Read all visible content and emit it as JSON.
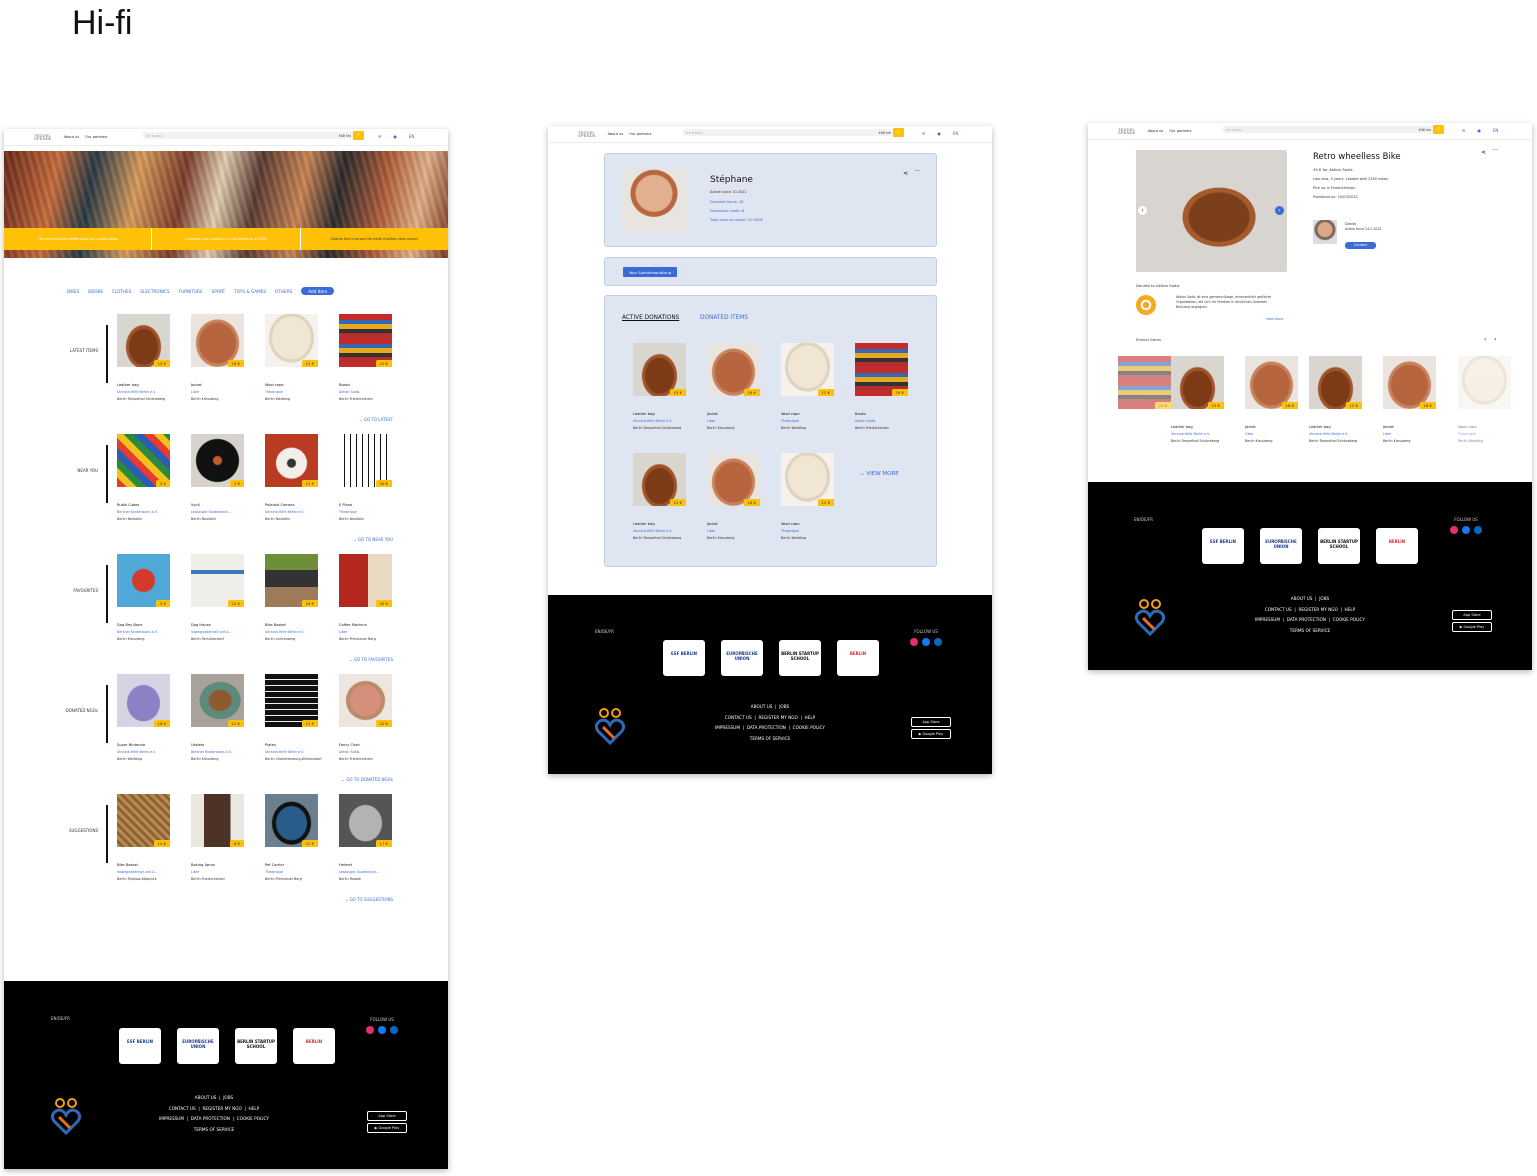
{
  "heading": "Hi-fi",
  "nav": {
    "logo_line1": "TEDDEL",
    "logo_line2": "SPENDE",
    "links": [
      "About us",
      "Our partners"
    ],
    "search_placeholder": "Ich suche...",
    "location_label": "Ort",
    "radius": "+10 km",
    "lang": "EN"
  },
  "home": {
    "banner": [
      "The second-hand market place for a good cause",
      "Exchange your goods in + a donations to an NGO",
      "Objects find a second life while charities raise money"
    ],
    "categories": [
      "BIKES",
      "BOOKS",
      "CLOTHES",
      "ELECTRONICS",
      "FURNITURE",
      "SPORT",
      "TOYS & GAMES",
      "OTHERS"
    ],
    "add_item": "Add Item",
    "sections": [
      {
        "name": "LATEST ITEMS",
        "goto": "GO TO LATEST",
        "items": [
          {
            "title": "Leather bag",
            "org": "Ukraine-Hilfe Berlin e.V.",
            "city": "Berlin Tempelhof-Schöneberg",
            "price": "15 €",
            "img": "bag"
          },
          {
            "title": "Jacket",
            "org": "Liber",
            "city": "Berlin Kreuzberg",
            "price": "18 €",
            "img": "jacket"
          },
          {
            "title": "Wool cape",
            "org": "Theatrigue",
            "city": "Berlin Wedding",
            "price": "12 €",
            "img": "cape"
          },
          {
            "title": "Books",
            "org": "Aktion Sodis",
            "city": "Berlin Friedrichshain",
            "price": "20 €",
            "img": "books"
          }
        ]
      },
      {
        "name": "NEAR YOU",
        "goto": "GO TO NEAR YOU",
        "items": [
          {
            "title": "Rubik Cubes",
            "org": "Berliner Kindertoons e.V.",
            "city": "Berlin Neukölln",
            "price": "5 €",
            "img": "cubes"
          },
          {
            "title": "Vynil",
            "org": "Lesßzugel Studentisch...",
            "city": "Berlin Neukölln",
            "price": "3 €",
            "img": "vinyl"
          },
          {
            "title": "Polaroid Camera",
            "org": "Ukraine-Hilfe Berlin e.V.",
            "city": "Berlin Neukölln",
            "price": "12 €",
            "img": "camera"
          },
          {
            "title": "E Piano",
            "org": "Theatrigue",
            "city": "Berlin Neukölln",
            "price": "30 €",
            "img": "piano"
          }
        ]
      },
      {
        "name": "FAVOURITES",
        "goto": "GO TO FAVOURITES",
        "items": [
          {
            "title": "Dog Bey Bone",
            "org": "Berliner Kindertoons e.V.",
            "city": "Berlin Kreuzberg",
            "price": "5 €",
            "img": "bone"
          },
          {
            "title": "Dog House",
            "org": "Vogelgnadenhof und A...",
            "city": "Berlin Reinickendorf",
            "price": "22 €",
            "img": "doghouse"
          },
          {
            "title": "Bike Basket",
            "org": "Ukraine-Hilfe Berlin e.V.",
            "city": "Berlin Lichtenberg",
            "price": "18 €",
            "img": "basket"
          },
          {
            "title": "Coffee Machine",
            "org": "Liber",
            "city": "Berlin Prenzlauer Berg",
            "price": "35 €",
            "img": "coffee"
          }
        ]
      },
      {
        "name": "DONATED NGOs",
        "goto": "GO TO DONATED NGOs",
        "items": [
          {
            "title": "Super Nintendo",
            "org": "Ukraine-Hilfe Berlin e.V.",
            "city": "Berlin Wedding",
            "price": "18 €",
            "img": "nintendo"
          },
          {
            "title": "Ukelele",
            "org": "Berliner Kindertoons e.V.",
            "city": "Berlin Kreuzberg",
            "price": "12 €",
            "img": "ukulele"
          },
          {
            "title": "Plates",
            "org": "Ukraine-Hilfe Berlin e.V.",
            "city": "Berlin Charlottenburg-Wilmersdorf",
            "price": "12 €",
            "img": "plates"
          },
          {
            "title": "Fancy Chair",
            "org": "Aktion Sodis",
            "city": "Berlin Friedrichshain",
            "price": "22 €",
            "img": "chair"
          }
        ]
      },
      {
        "name": "SUGGESTIONS",
        "goto": "GO TO SUGGESTIONS",
        "items": [
          {
            "title": "Bike Basket",
            "org": "Vogelgnadenhof und A...",
            "city": "Berlin Treptow-Köpenick",
            "price": "10 €",
            "img": "basket2"
          },
          {
            "title": "Baking Apron",
            "org": "Liber",
            "city": "Berlin Friedrichshain",
            "price": "8 €",
            "img": "apron"
          },
          {
            "title": "Pet Carrier",
            "org": "Theatrigue",
            "city": "Berlin Prenzlauer Berg",
            "price": "22 €",
            "img": "carrier"
          },
          {
            "title": "Helmet",
            "org": "Lesßzugel Studentisch...",
            "city": "Berlin Moabit",
            "price": "17 €",
            "img": "helmet"
          }
        ]
      }
    ]
  },
  "footer": {
    "lang": "EN/DE/FR",
    "follow": "FOLLOW US",
    "badges": [
      "ESF BERLIN",
      "EUROPÄISCHE UNION",
      "BERLIN STARTUP SCHOOL",
      "BERLIN"
    ],
    "row1": [
      "ABOUT US",
      "JOBS"
    ],
    "row2": [
      "CONTACT US",
      "REGISTER MY NGO",
      "HELP"
    ],
    "row3": [
      "IMPRESSUM",
      "DATA PROTECTION",
      "COOKIE POLICY"
    ],
    "row4": [
      "TERMS OF SERVICE"
    ],
    "app_store": "App Store",
    "google_play": "Google Play"
  },
  "profile": {
    "name": "Stéphane",
    "active_since": "Active since 10.2021",
    "donated_items": "Donated items: 18",
    "donations_made": "Donations made: 8",
    "total_raised": "Total amount raised: 20 000€",
    "receipt_button": "Your Spendenquittung",
    "tab_active": "ACTIVE DONATIONS",
    "tab_donated": "DONATED ITEMS",
    "view_more": "VIEW MORE",
    "items": [
      {
        "title": "Leather bag",
        "org": "Ukraine-Hilfe Berlin e.V.",
        "city": "Berlin Tempelhof-Schöneberg",
        "price": "15 €",
        "img": "bag"
      },
      {
        "title": "Jacket",
        "org": "Liber",
        "city": "Berlin Kreuzberg",
        "price": "18 €",
        "img": "jacket"
      },
      {
        "title": "Wool cape",
        "org": "Theatrigue",
        "city": "Berlin Wedding",
        "price": "12 €",
        "img": "cape"
      },
      {
        "title": "Books",
        "org": "Aktion Sodis",
        "city": "Berlin Friedrichshain",
        "price": "20 €",
        "img": "books"
      },
      {
        "title": "Leather bag",
        "org": "Ukraine-Hilfe Berlin e.V.",
        "city": "Berlin Tempelhof-Schöneberg",
        "price": "15 €",
        "img": "bag"
      },
      {
        "title": "Jacket",
        "org": "Liber",
        "city": "Berlin Kreuzberg",
        "price": "18 €",
        "img": "jacket"
      },
      {
        "title": "Wool cape",
        "org": "Theatrigue",
        "city": "Berlin Wedding",
        "price": "12 €",
        "img": "cape"
      }
    ]
  },
  "detail": {
    "title": "Retro wheelless Bike",
    "price_line": "45 € for Aktion Sodis",
    "condition": "Like new, 3 years, Loaded with 2300 notes",
    "pickup": "Pick up in Friedrichshain",
    "published": "Published on: 20/03/2022",
    "seller_name": "Daniel",
    "seller_since": "Active since 24.2.2022",
    "contact": "Contact",
    "donate_to": "Donate to Aktion Sodis",
    "ngo_text": "Aktion Sodis ist eine gemeinnützige, ehrenamtlich geführte Organisation, die sich für Familien in ländlichen Gebieten Bolivians engagiert.",
    "read_more": "read more",
    "similar": "Similar items",
    "similar_items": [
      {
        "title": "",
        "org": "",
        "city": "",
        "price": "20 €",
        "img": "books"
      },
      {
        "title": "Leather bag",
        "org": "Ukraine-Hilfe Berlin e.V.",
        "city": "Berlin Tempelhof-Schöneberg",
        "price": "15 €",
        "img": "bag"
      },
      {
        "title": "Jacket",
        "org": "Liber",
        "city": "Berlin Kreuzberg",
        "price": "18 €",
        "img": "jacket"
      },
      {
        "title": "Leather bag",
        "org": "Ukraine-Hilfe Berlin e.V.",
        "city": "Berlin Tempelhof-Schöneberg",
        "price": "15 €",
        "img": "bag"
      },
      {
        "title": "Jacket",
        "org": "Liber",
        "city": "Berlin Kreuzberg",
        "price": "18 €",
        "img": "jacket"
      },
      {
        "title": "Wool cape",
        "org": "Theatrigue",
        "city": "Berlin Wedding",
        "price": "",
        "img": "cape"
      }
    ]
  },
  "colors": {
    "accent": "#3b6bd6",
    "yellow": "#ffc107",
    "panel": "#dfe5f1"
  }
}
